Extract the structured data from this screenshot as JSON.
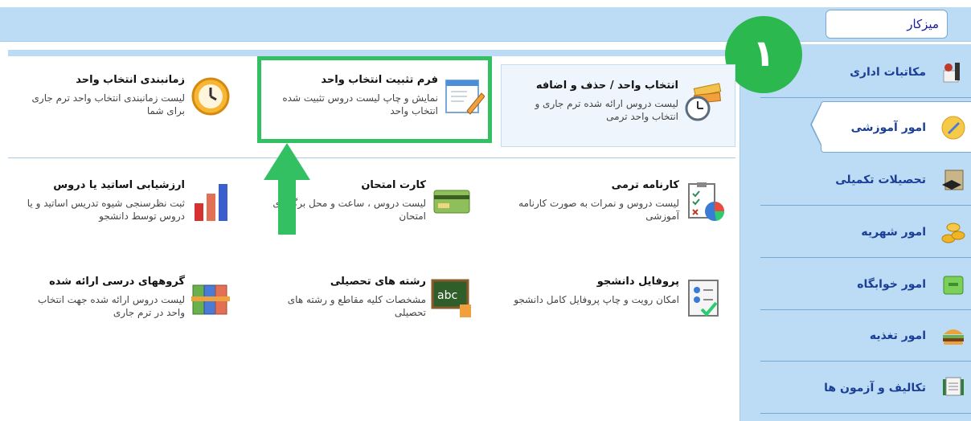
{
  "header": {
    "desk_label": "میزکار"
  },
  "step_badge": "۱",
  "sidebar": {
    "items": [
      {
        "label": "مکاتبات اداری",
        "icon": "office-letter-icon"
      },
      {
        "label": "امور آموزشی",
        "icon": "education-icon",
        "active": true
      },
      {
        "label": "تحصیلات تکمیلی",
        "icon": "graduate-icon"
      },
      {
        "label": "امور شهریه",
        "icon": "coins-icon"
      },
      {
        "label": "امور خوابگاه",
        "icon": "dorm-icon"
      },
      {
        "label": "امور تغذیه",
        "icon": "food-icon"
      },
      {
        "label": "تکالیف و آزمون ها",
        "icon": "exam-icon"
      }
    ]
  },
  "cards": [
    {
      "title": "انتخاب واحد / حذف و اضافه",
      "desc": "لیست دروس ارائه شده ترم جاری و انتخاب واحد ترمی",
      "icon": "books-clock-icon"
    },
    {
      "title": "فرم تثبیت انتخاب واحد",
      "desc": "نمایش و چاپ لیست دروس تثبیت شده انتخاب واحد",
      "icon": "form-edit-icon"
    },
    {
      "title": "زمانبندی انتخاب واحد",
      "desc": "لیست زمانبندی انتخاب واحد ترم جاری برای شما",
      "icon": "clock-icon"
    },
    {
      "title": "کارنامه ترمی",
      "desc": "لیست دروس و نمرات به صورت کارنامه آموزشی",
      "icon": "report-chart-icon"
    },
    {
      "title": "کارت امتحان",
      "desc": "لیست دروس ، ساعت و محل برگزاری امتحان",
      "icon": "card-icon"
    },
    {
      "title": "ارزشیابی اساتید یا دروس",
      "desc": "ثبت نظرسنجی شیوه تدریس اساتید و یا دروس توسط دانشجو",
      "icon": "bar-chart-icon"
    },
    {
      "title": "پروفایل دانشجو",
      "desc": "امکان رویت و چاپ پروفایل کامل دانشجو",
      "icon": "profile-icon"
    },
    {
      "title": "رشته های تحصیلی",
      "desc": "مشخصات کلیه مقاطع و رشته های تحصیلی",
      "icon": "chalkboard-icon"
    },
    {
      "title": "گروههای درسی ارائه شده",
      "desc": "لیست دروس ارائه شده جهت انتخاب واحد در ترم جاری",
      "icon": "book-group-icon"
    }
  ],
  "colors": {
    "accent_green": "#33c063",
    "badge_green": "#2bb84f",
    "sidebar_bg": "#bcdcf6"
  }
}
